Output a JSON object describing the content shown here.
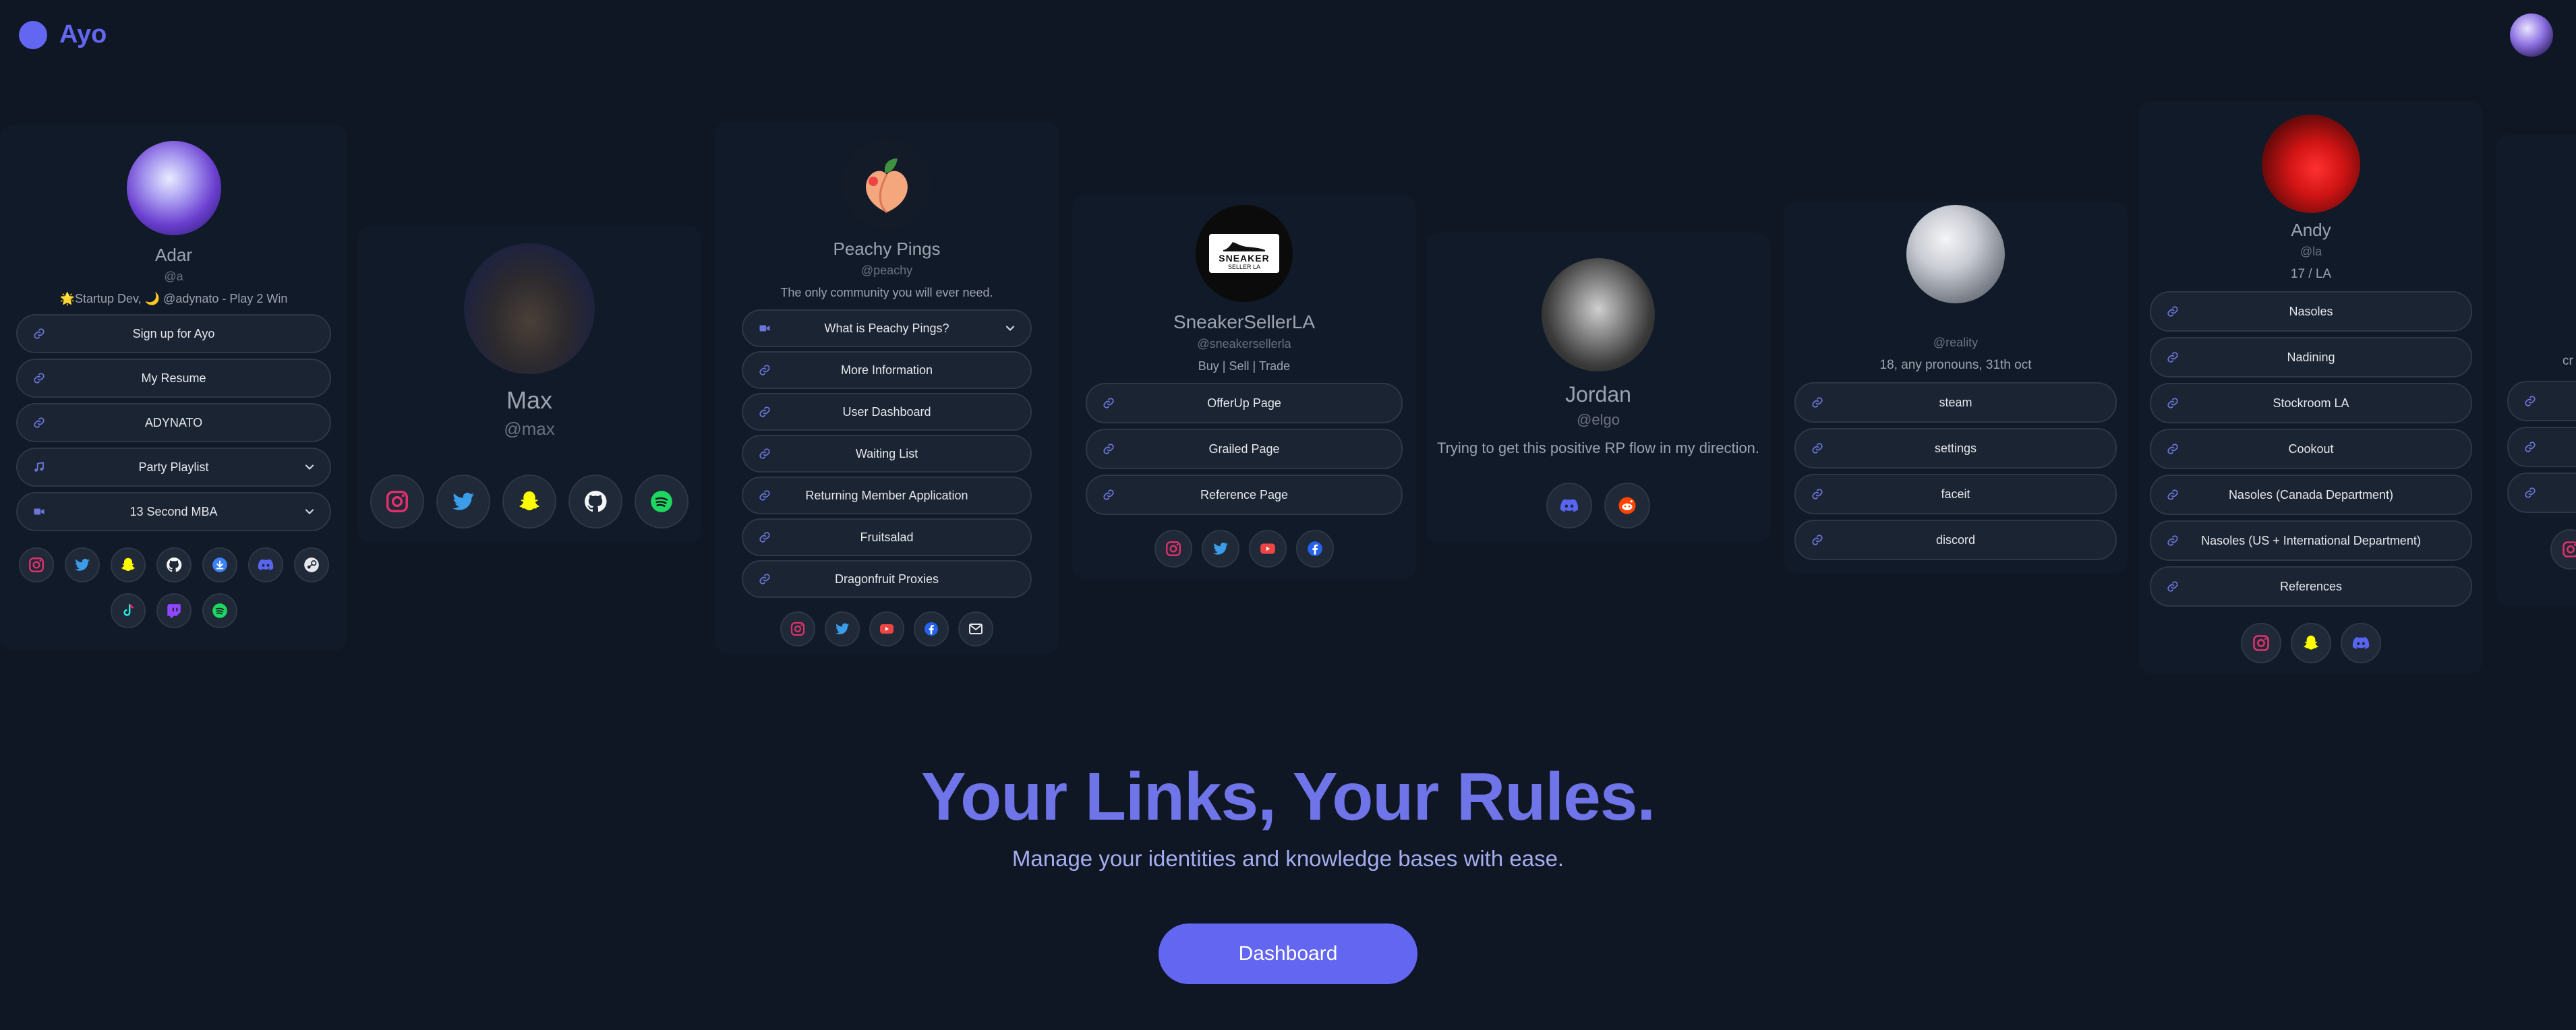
{
  "app": {
    "name": "Ayo",
    "accent": "#6366f1"
  },
  "cards": {
    "adar": {
      "name": "Adar",
      "handle": "@a",
      "bio": "🌟Startup Dev, 🌙 @adynato - Play 2 Win",
      "links": [
        "Sign up for Ayo",
        "My Resume",
        "ADYNATO",
        "Party Playlist",
        "13 Second MBA"
      ],
      "socials": [
        "instagram-icon",
        "twitter-icon",
        "snapchat-icon",
        "github-icon",
        "download-icon",
        "discord-icon",
        "steam-icon",
        "tiktok-icon",
        "twitch-icon",
        "spotify-icon"
      ]
    },
    "max": {
      "name": "Max",
      "handle": "@max",
      "socials": [
        "instagram-icon",
        "twitter-icon",
        "snapchat-icon",
        "github-icon",
        "spotify-icon"
      ]
    },
    "peachy": {
      "name": "Peachy Pings",
      "handle": "@peachy",
      "bio": "The only community you will ever need.",
      "links": [
        "What is Peachy Pings?",
        "More Information",
        "User Dashboard",
        "Waiting List",
        "Returning Member Application",
        "Fruitsalad",
        "Dragonfruit Proxies"
      ],
      "socials": [
        "instagram-icon",
        "twitter-icon",
        "youtube-icon",
        "facebook-icon",
        "email-icon"
      ]
    },
    "sneaker": {
      "name": "SneakerSellerLA",
      "handle": "@sneakersellerla",
      "bio": "Buy | Sell | Trade",
      "logo_top": "SNEAKER",
      "logo_bottom": "SELLER LA",
      "links": [
        "OfferUp Page",
        "Grailed Page",
        "Reference Page"
      ],
      "socials": [
        "instagram-icon",
        "twitter-icon",
        "youtube-icon",
        "facebook-icon"
      ]
    },
    "jordan": {
      "name": "Jordan",
      "handle": "@elgo",
      "bio": "Trying to get this positive RP flow in my direction.",
      "socials": [
        "discord-icon",
        "reddit-icon"
      ]
    },
    "reality": {
      "handle": "@reality",
      "bio": "18, any pronouns, 31th oct",
      "links": [
        "steam",
        "settings",
        "faceit",
        "discord"
      ]
    },
    "andy": {
      "name": "Andy",
      "handle": "@la",
      "bio": "17 / LA",
      "links": [
        "Nasoles",
        "Nadining",
        "Stockroom LA",
        "Cookout",
        "Nasoles (Canada Department)",
        "Nasoles (US + International Department)",
        "References"
      ],
      "socials": [
        "instagram-icon",
        "snapchat-icon",
        "discord-icon"
      ]
    },
    "partial": {
      "bio": "cr"
    }
  },
  "hero": {
    "title": "Your Links, Your Rules.",
    "subtitle": "Manage your identities and knowledge bases with ease.",
    "cta": "Dashboard"
  }
}
